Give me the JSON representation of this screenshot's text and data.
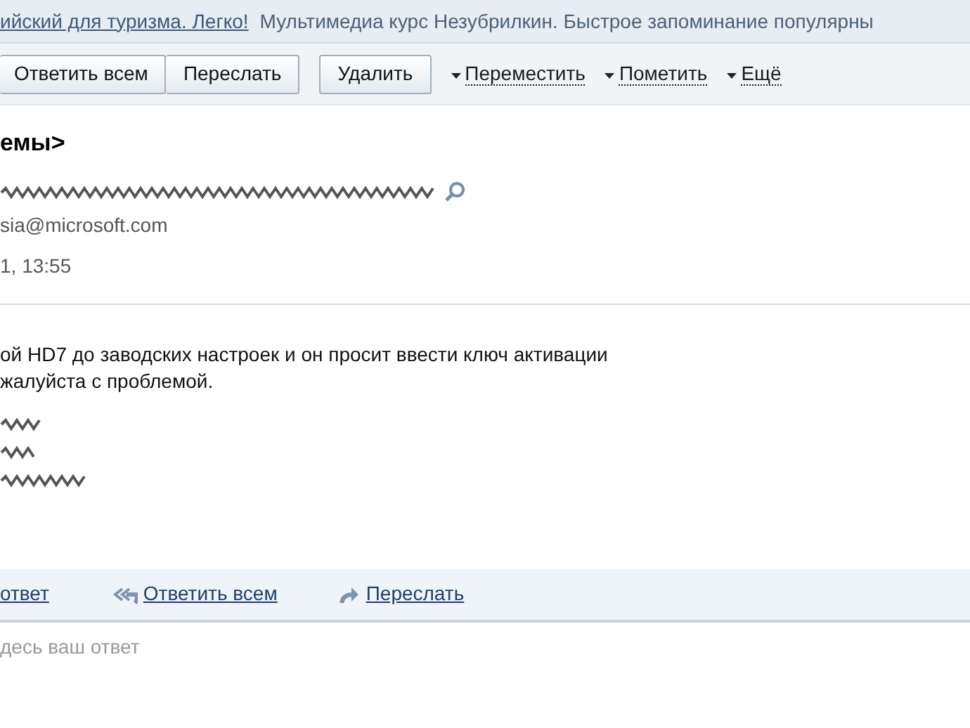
{
  "ad_bar": {
    "link": "ийский для туризма. Легко!",
    "text": "Мультимедиа курс Незубрилкин. Быстрое запоминание популярны"
  },
  "toolbar": {
    "button_groups": [
      [
        "Ответить всем",
        "Переслать"
      ],
      [
        "Удалить"
      ]
    ],
    "menus": [
      {
        "label": "Переместить"
      },
      {
        "label": "Пометить"
      },
      {
        "label": "Ещё"
      }
    ]
  },
  "message": {
    "subject": "емы>",
    "sender_email": "sia@microsoft.com",
    "date": "1, 13:55",
    "body": [
      "ой HD7 до заводских настроек и он просит ввести ключ активации",
      "жалуйста с проблемой."
    ]
  },
  "reply_bar": [
    {
      "label": "ответ",
      "kind": "reply"
    },
    {
      "label": "Ответить всем",
      "kind": "reply_all"
    },
    {
      "label": "Переслать",
      "kind": "forward"
    }
  ],
  "reply_field": {
    "placeholder": "десь ваш ответ"
  }
}
